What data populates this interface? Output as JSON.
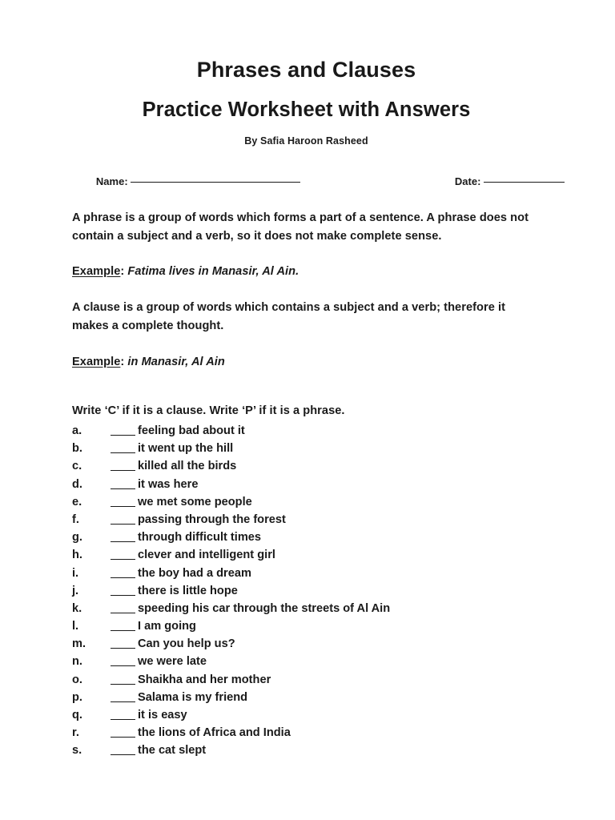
{
  "document": {
    "title_line_1": "Phrases and Clauses",
    "title_line_2": "Practice Worksheet with Answers",
    "byline": "By Safia Haroon Rasheed"
  },
  "fields": {
    "name_label": "Name: ",
    "name_value": "",
    "date_label": "Date: ",
    "date_value": ""
  },
  "body": {
    "phrase_definition": "A phrase is a group of words which forms a part of a sentence. A phrase does not contain a subject and a verb, so it does not make complete sense.",
    "example_label_1": "Example",
    "example_colon_1": ": ",
    "example_text_1": "Fatima lives in Manasir, Al Ain.",
    "clause_definition": "A clause is a group of words which contains a subject and a verb; therefore it makes a complete thought.",
    "example_label_2": "Example",
    "example_colon_2": ": ",
    "example_text_2": "in Manasir, Al Ain"
  },
  "exercise": {
    "instruction": "Write ‘C’ if it is a clause. Write ‘P’ if it is a phrase.",
    "items": [
      {
        "letter": "a.",
        "blank": "",
        "text": "feeling bad about it"
      },
      {
        "letter": "b.",
        "blank": "",
        "text": "it went up the hill"
      },
      {
        "letter": "c.",
        "blank": "",
        "text": "killed all the birds"
      },
      {
        "letter": "d.",
        "blank": "",
        "text": "it was here"
      },
      {
        "letter": "e.",
        "blank": "",
        "text": "we met some people"
      },
      {
        "letter": "f.",
        "blank": "",
        "text": "passing through the forest"
      },
      {
        "letter": "g.",
        "blank": "",
        "text": "through difficult times"
      },
      {
        "letter": "h.",
        "blank": "",
        "text": "clever and intelligent girl"
      },
      {
        "letter": "i.",
        "blank": "",
        "text": "the boy had a dream"
      },
      {
        "letter": "j.",
        "blank": "",
        "text": "there is little hope"
      },
      {
        "letter": "k.",
        "blank": "",
        "text": "speeding his car through the streets of Al Ain"
      },
      {
        "letter": "l.",
        "blank": "",
        "text": "I am going"
      },
      {
        "letter": "m.",
        "blank": "",
        "text": "Can you help us?"
      },
      {
        "letter": "n.",
        "blank": "",
        "text": "we were late"
      },
      {
        "letter": "o.",
        "blank": "",
        "text": "Shaikha and her mother"
      },
      {
        "letter": "p.",
        "blank": "",
        "text": "Salama is my friend"
      },
      {
        "letter": "q.",
        "blank": "",
        "text": "it is easy"
      },
      {
        "letter": "r.",
        "blank": "",
        "text": "the lions of Africa and India"
      },
      {
        "letter": "s.",
        "blank": "",
        "text": "the cat slept"
      }
    ]
  },
  "colors": {
    "page_background": "#ffffff",
    "text": "#1a1a1a"
  }
}
